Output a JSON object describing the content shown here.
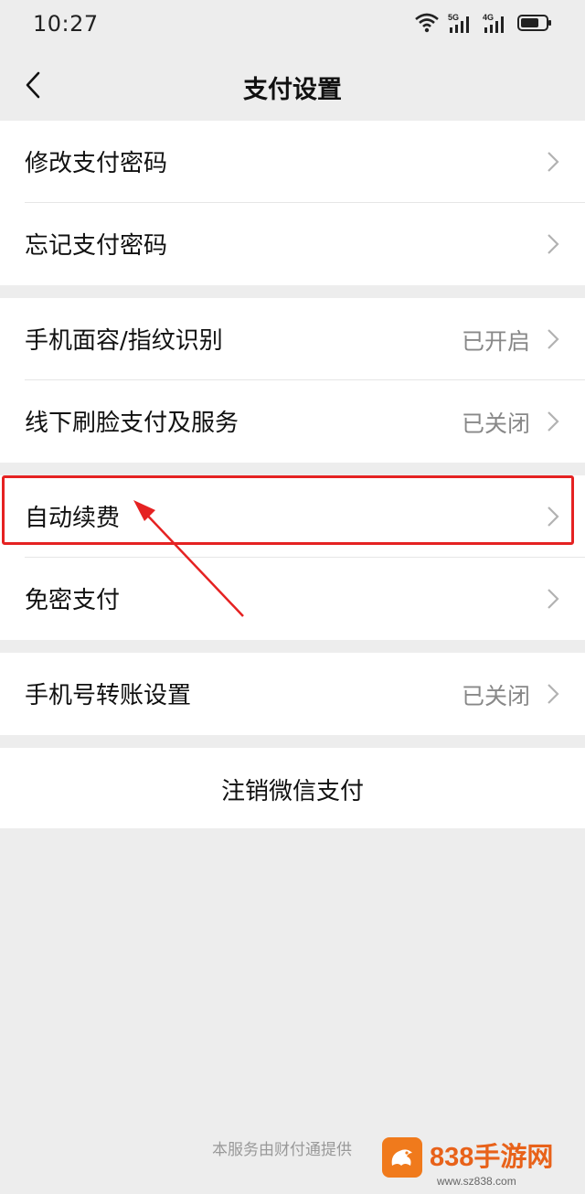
{
  "status_bar": {
    "time": "10:27",
    "network_1": "5G",
    "network_2": "4G"
  },
  "header": {
    "title": "支付设置",
    "back_icon": "chevron-left-icon"
  },
  "groups": [
    {
      "items": [
        {
          "label": "修改支付密码",
          "value": ""
        },
        {
          "label": "忘记支付密码",
          "value": ""
        }
      ]
    },
    {
      "items": [
        {
          "label": "手机面容/指纹识别",
          "value": "已开启"
        },
        {
          "label": "线下刷脸支付及服务",
          "value": "已关闭"
        }
      ]
    },
    {
      "items": [
        {
          "label": "自动续费",
          "value": ""
        },
        {
          "label": "免密支付",
          "value": ""
        }
      ]
    },
    {
      "items": [
        {
          "label": "手机号转账设置",
          "value": "已关闭"
        }
      ]
    },
    {
      "items": [
        {
          "label": "注销微信支付",
          "value": ""
        }
      ]
    }
  ],
  "footer": {
    "text": "本服务由财付通提供"
  },
  "watermark": {
    "brand": "838手游网",
    "url": "www.sz838.com"
  },
  "colors": {
    "background": "#ededed",
    "highlight": "#e52222",
    "watermark": "#e8621a"
  }
}
